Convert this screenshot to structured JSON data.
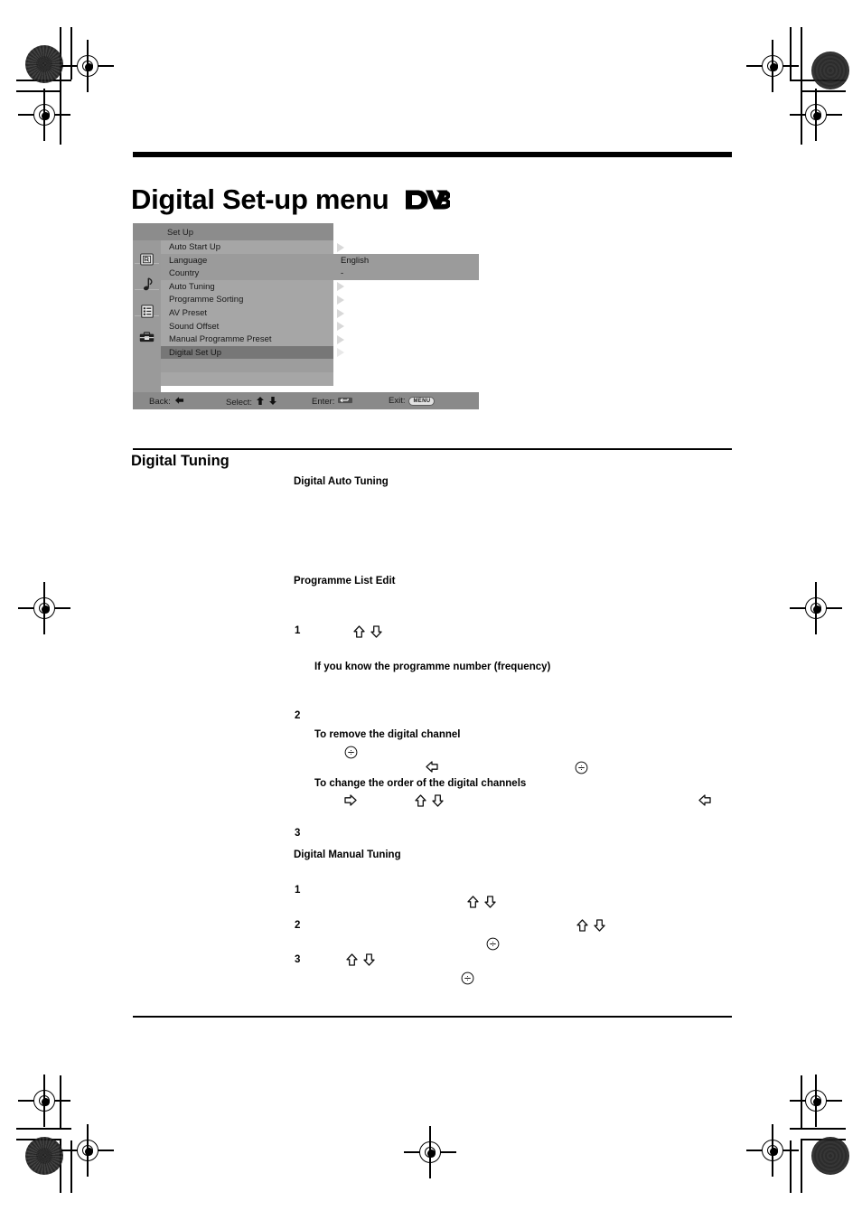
{
  "document": {
    "title": "Digital Set-up menu",
    "title_logo": "dvb-logo",
    "section_heading": "Digital Tuning",
    "subsections": [
      {
        "label": "Digital Auto Tuning"
      },
      {
        "label": "Programme List Edit"
      },
      {
        "label": "If you know the programme number (frequency)"
      },
      {
        "label": "To remove the digital channel"
      },
      {
        "label": "To change the order of the digital channels"
      },
      {
        "label": "Digital Manual Tuning"
      }
    ],
    "step_numbers": [
      "1",
      "2",
      "3",
      "1",
      "2",
      "3"
    ],
    "glyphs": {
      "up_arrow": "up-arrow-outline-icon",
      "down_arrow": "down-arrow-outline-icon",
      "left_arrow": "left-arrow-outline-icon",
      "right_arrow": "right-arrow-outline-icon",
      "enter_circle": "circle-enter-icon"
    }
  },
  "osd": {
    "title": "Set Up",
    "sidebar_icons": [
      {
        "name": "picture-icon"
      },
      {
        "name": "sound-note-icon"
      },
      {
        "name": "features-list-icon"
      },
      {
        "name": "setup-toolbox-icon"
      }
    ],
    "rows": [
      {
        "label": "Auto Start Up",
        "value": "",
        "has_arrow": true,
        "selected": false,
        "wide": false
      },
      {
        "label": "Language",
        "value": "English",
        "has_arrow": false,
        "selected": false,
        "wide": true
      },
      {
        "label": "Country",
        "value": "-",
        "has_arrow": false,
        "selected": false,
        "wide": true
      },
      {
        "label": "Auto Tuning",
        "value": "",
        "has_arrow": true,
        "selected": false,
        "wide": false
      },
      {
        "label": "Programme Sorting",
        "value": "",
        "has_arrow": true,
        "selected": false,
        "wide": false
      },
      {
        "label": "AV Preset",
        "value": "",
        "has_arrow": true,
        "selected": false,
        "wide": false
      },
      {
        "label": "Sound Offset",
        "value": "",
        "has_arrow": true,
        "selected": false,
        "wide": false
      },
      {
        "label": "Manual Programme Preset",
        "value": "",
        "has_arrow": true,
        "selected": false,
        "wide": false
      },
      {
        "label": "Digital Set Up",
        "value": "",
        "has_arrow": true,
        "selected": true,
        "wide": false
      },
      {
        "label": "",
        "value": "",
        "has_arrow": false,
        "selected": false,
        "wide": false
      },
      {
        "label": "",
        "value": "",
        "has_arrow": false,
        "selected": false,
        "wide": false
      }
    ],
    "hints": [
      {
        "label": "Back:",
        "glyph": "left-arrow-solid-icon"
      },
      {
        "label": "Select:",
        "glyph": "up-down-arrows-solid-icon"
      },
      {
        "label": "Enter:",
        "glyph": "enter-key-icon"
      },
      {
        "label": "Exit:",
        "glyph": "menu-button-icon",
        "pill": "MENU"
      }
    ],
    "colors": {
      "title_bar": "#8c8c8c",
      "row": "#a6a6a6",
      "row_wide": "#9b9b9b",
      "row_selected": "#777777",
      "sidebar": "#9a9a9a",
      "hint_bar": "#8a8a8a"
    }
  }
}
